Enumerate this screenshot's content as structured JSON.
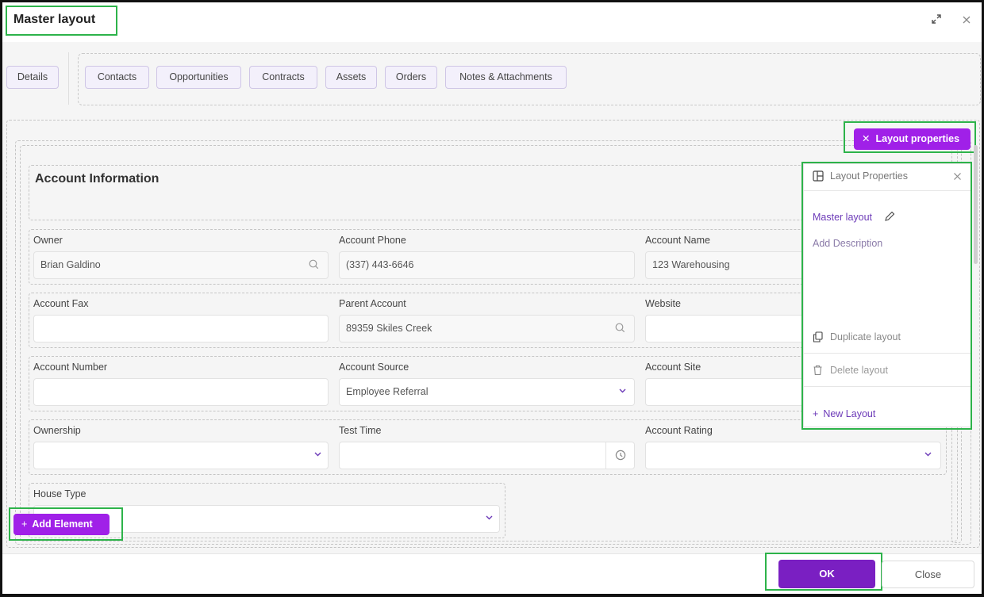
{
  "dialog": {
    "title": "Master layout"
  },
  "tabs": {
    "details": "Details",
    "items": [
      "Contacts",
      "Opportunities",
      "Contracts",
      "Assets",
      "Orders",
      "Notes & Attachments"
    ]
  },
  "layout_properties_button": "Layout properties",
  "section": {
    "title": "Account Information"
  },
  "fields": {
    "owner": {
      "label": "Owner",
      "value": "Brian Galdino"
    },
    "account_phone": {
      "label": "Account Phone",
      "value": "(337) 443-6646"
    },
    "account_name": {
      "label": "Account Name",
      "value": "123 Warehousing"
    },
    "account_fax": {
      "label": "Account Fax",
      "value": ""
    },
    "parent_account": {
      "label": "Parent Account",
      "value": "89359 Skiles Creek"
    },
    "website": {
      "label": "Website",
      "value": ""
    },
    "account_number": {
      "label": "Account Number",
      "value": ""
    },
    "account_source": {
      "label": "Account Source",
      "value": "Employee Referral"
    },
    "account_site": {
      "label": "Account Site",
      "value": ""
    },
    "ownership": {
      "label": "Ownership",
      "value": ""
    },
    "test_time": {
      "label": "Test Time",
      "value": ""
    },
    "account_rating": {
      "label": "Account Rating",
      "value": ""
    },
    "house_type": {
      "label": "House Type",
      "value": ""
    }
  },
  "add_element_button": "Add Element",
  "panel": {
    "header": "Layout Properties",
    "layout_name": "Master layout",
    "description_placeholder": "Add Description",
    "duplicate": "Duplicate layout",
    "delete": "Delete layout",
    "new_layout": "New Layout"
  },
  "footer": {
    "ok": "OK",
    "close": "Close"
  },
  "colors": {
    "accent_purple": "#a020e8",
    "ok_purple": "#7a1fc2",
    "highlight_green": "#2db34a",
    "link_purple": "#6c3ab8"
  }
}
